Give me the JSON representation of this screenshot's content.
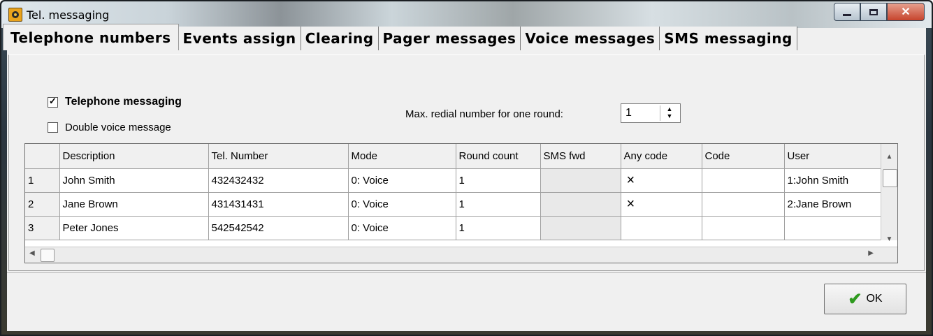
{
  "window": {
    "title": "Tel. messaging"
  },
  "tabs": [
    "Telephone numbers",
    "Events assign",
    "Clearing",
    "Pager messages",
    "Voice messages",
    "SMS messaging"
  ],
  "options": {
    "telephone_messaging": "Telephone messaging",
    "double_voice": "Double voice message",
    "redial_label": "Max. redial number for one round:",
    "redial_value": "1"
  },
  "table": {
    "columns": [
      "",
      "Description",
      "Tel. Number",
      "Mode",
      "Round count",
      "SMS fwd",
      "Any code",
      "Code",
      "User"
    ],
    "rows": [
      [
        "1",
        "John Smith",
        "432432432",
        "0: Voice",
        "1",
        "",
        "×",
        "",
        "1:John Smith"
      ],
      [
        "2",
        "Jane Brown",
        "431431431",
        "0: Voice",
        "1",
        "",
        "×",
        "",
        "2:Jane Brown"
      ],
      [
        "3",
        "Peter Jones",
        "542542542",
        "0: Voice",
        "1",
        "",
        "",
        "",
        ""
      ]
    ]
  },
  "buttons": {
    "ok": "OK"
  }
}
